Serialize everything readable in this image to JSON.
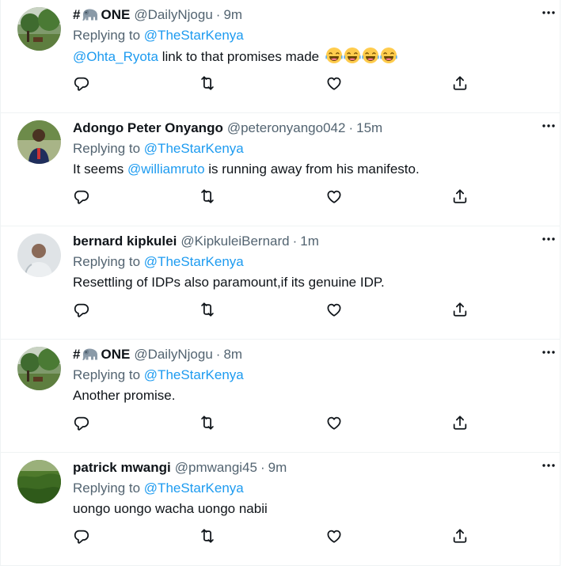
{
  "colors": {
    "link": "#1d9bf0",
    "muted": "#536471",
    "text": "#0f1419",
    "divider": "#eff3f4"
  },
  "icons": {
    "reply": "reply-icon",
    "retweet": "retweet-icon",
    "like": "like-icon",
    "share": "share-icon",
    "more": "more-icon"
  },
  "tweets": [
    {
      "name_prefix": "#",
      "name_suffix": "ONE",
      "name_emoji": "elephant-emoji",
      "handle": "@DailyNjogu",
      "dot": "·",
      "time": "9m",
      "replying_label": "Replying to",
      "replying_to": "@TheStarKenya",
      "mention": "@Ohta_Ryota",
      "text": " link to that promises made",
      "emoji": "joy-emoji ×4"
    },
    {
      "name": "Adongo Peter Onyango",
      "handle": "@peteronyango042",
      "dot": "·",
      "time": "15m",
      "replying_label": "Replying to",
      "replying_to": "@TheStarKenya",
      "text_before": "It seems ",
      "mention": "@williamruto",
      "text_after": " is running away from his manifesto."
    },
    {
      "name": "bernard kipkulei",
      "handle": "@KipkuleiBernard",
      "dot": "·",
      "time": "1m",
      "replying_label": "Replying to",
      "replying_to": "@TheStarKenya",
      "text": "Resettling of IDPs also paramount,if its genuine IDP."
    },
    {
      "name_prefix": "#",
      "name_suffix": "ONE",
      "name_emoji": "elephant-emoji",
      "handle": "@DailyNjogu",
      "dot": "·",
      "time": "8m",
      "replying_label": "Replying to",
      "replying_to": "@TheStarKenya",
      "text": "Another promise."
    },
    {
      "name": "patrick mwangi",
      "handle": "@pmwangi45",
      "dot": "·",
      "time": "9m",
      "replying_label": "Replying to",
      "replying_to": "@TheStarKenya",
      "text": "uongo uongo wacha uongo nabii"
    }
  ]
}
